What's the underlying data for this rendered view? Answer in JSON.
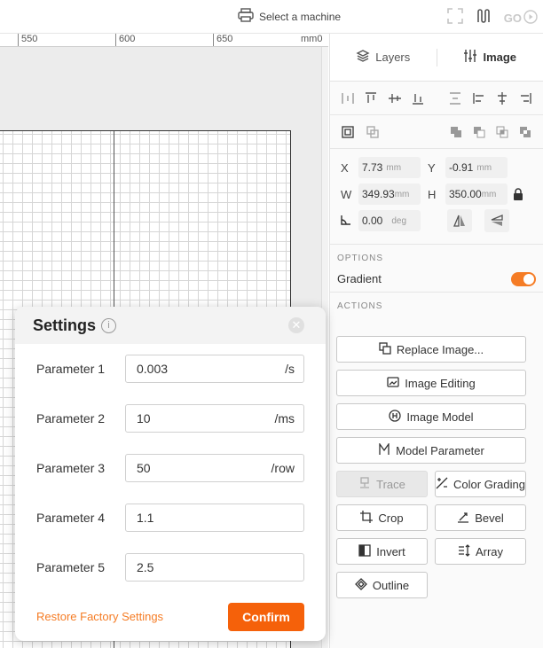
{
  "topbar": {
    "machine_label": "Select a machine",
    "go_label": "GO"
  },
  "ruler": {
    "ticks": [
      "550",
      "600",
      "650",
      "mm0"
    ]
  },
  "panel": {
    "tabs": {
      "layers": "Layers",
      "image": "Image"
    },
    "props": {
      "x_label": "X",
      "x_value": "7.73",
      "x_unit": "mm",
      "y_label": "Y",
      "y_value": "-0.91",
      "y_unit": "mm",
      "w_label": "W",
      "w_value": "349.93",
      "w_unit": "mm",
      "h_label": "H",
      "h_value": "350.00",
      "h_unit": "mm",
      "angle_value": "0.00",
      "angle_unit": "deg"
    },
    "options_header": "OPTIONS",
    "gradient_label": "Gradient",
    "gradient_on": true,
    "actions_header": "ACTIONS",
    "actions": {
      "replace": "Replace Image...",
      "editing": "Image Editing",
      "model": "Image Model",
      "model_param": "Model Parameter",
      "trace": "Trace",
      "color_grading": "Color Grading",
      "crop": "Crop",
      "bevel": "Bevel",
      "invert": "Invert",
      "array": "Array",
      "outline": "Outline"
    }
  },
  "dialog": {
    "title": "Settings",
    "params": [
      {
        "label": "Parameter 1",
        "value": "0.003",
        "unit": "/s"
      },
      {
        "label": "Parameter 2",
        "value": "10",
        "unit": "/ms"
      },
      {
        "label": "Parameter 3",
        "value": "50",
        "unit": "/row"
      },
      {
        "label": "Parameter 4",
        "value": "1.1",
        "unit": ""
      },
      {
        "label": "Parameter 5",
        "value": "2.5",
        "unit": ""
      }
    ],
    "restore_label": "Restore Factory Settings",
    "confirm_label": "Confirm"
  },
  "colors": {
    "accent": "#f5610a",
    "link": "#f57c25"
  }
}
